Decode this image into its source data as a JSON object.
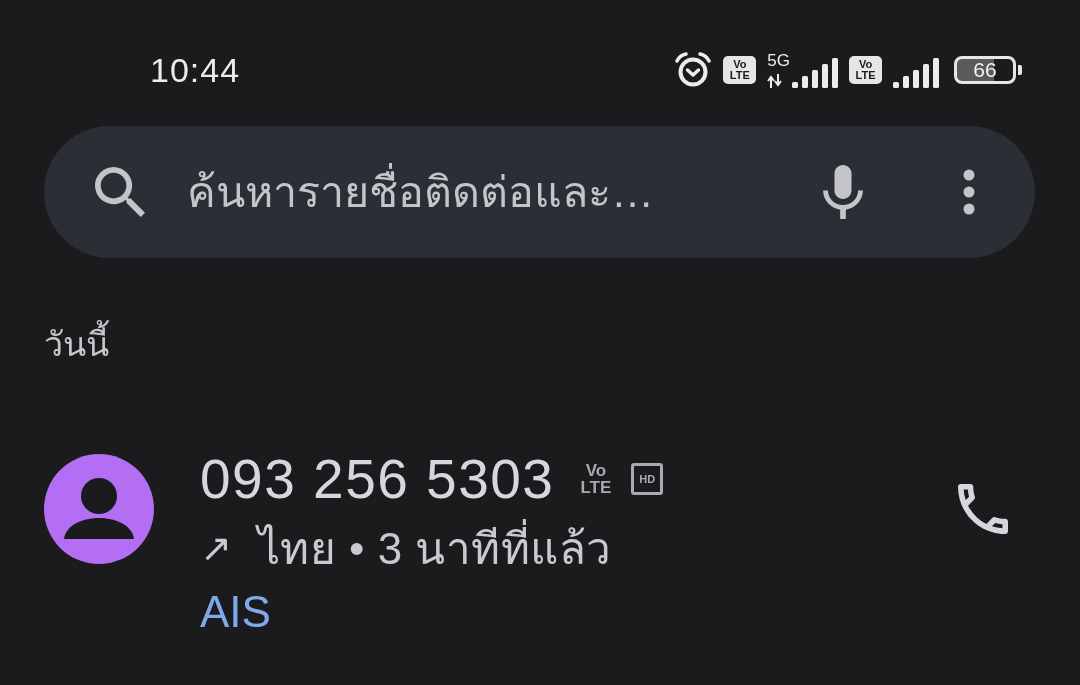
{
  "status_bar": {
    "time": "10:44",
    "indicators": [
      {
        "kind": "alarm"
      },
      {
        "kind": "volte",
        "lines": [
          "Vo",
          "LTE"
        ]
      },
      {
        "kind": "signal",
        "network": "5G"
      },
      {
        "kind": "volte",
        "lines": [
          "Vo",
          "LTE"
        ]
      },
      {
        "kind": "signal"
      }
    ],
    "battery": {
      "text": "66"
    }
  },
  "search": {
    "placeholder": "ค้นหารายชื่อติดต่อและ…"
  },
  "section_header": "วันนี้",
  "calls": [
    {
      "number": "093 256 5303",
      "color": "#b46ef3",
      "badges": [
        {
          "kind": "volte",
          "lines": [
            "Vo",
            "LTE"
          ]
        },
        {
          "kind": "hd",
          "text": "HD"
        }
      ],
      "direction_arrow": "↗",
      "details": "ไทย • 3 นาทีที่แล้ว",
      "carrier": "AIS"
    }
  ]
}
